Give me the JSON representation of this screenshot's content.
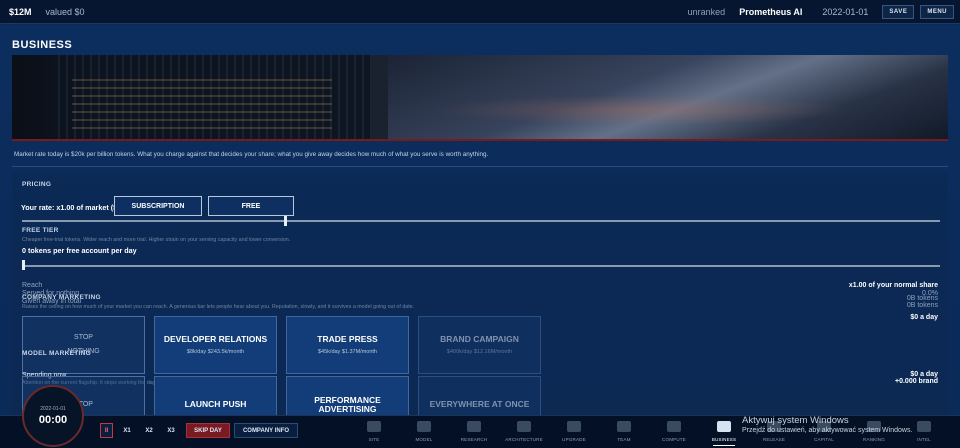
{
  "topbar": {
    "cash": "$12M",
    "valued": "valued $0",
    "rank": "unranked",
    "company": "Prometheus AI",
    "date": "2022-01-01",
    "save_label": "SAVE",
    "menu_label": "MENU"
  },
  "page": {
    "title": "BUSINESS",
    "intro": "Market rate today is $20k per billion tokens. What you charge against that decides your share; what you give away decides how much of what you serve is worth anything."
  },
  "pricing": {
    "heading": "PRICING",
    "rate_text": "Your rate: x1.00 of market ($20k/B tokens)",
    "options": [
      "SUBSCRIPTION",
      "FREE"
    ],
    "rate_multiplier": 1.0,
    "free_tier_heading": "FREE TIER",
    "free_tier_hint": "Cheaper free-trial tokens. Wider reach and more trial. Higher strain on your serving capacity and lower conversion.",
    "free_tier_value": "0 tokens per free account per day",
    "free_tier_fraction": 0.0,
    "reach_label": "Reach",
    "reach_value": "x1.00 of your normal share",
    "served_label": "Served for nothing",
    "served_value": "0.0%",
    "given_label": "Given away in total",
    "given_value": "0B tokens",
    "given_value2": "0B tokens"
  },
  "company_marketing": {
    "heading": "COMPANY MARKETING",
    "hint": "Raises the ceiling on how much of your market you can reach. A generous bar lets people hear about you. Reputation, slowly, and it survives a model going out of date.",
    "rate": "$0 a day",
    "cards": [
      {
        "title": "STOP",
        "sub": "NOTHING",
        "style": "ghost"
      },
      {
        "title": "DEVELOPER RELATIONS",
        "sub": "$8k/day   $243.5k/month",
        "style": "normal"
      },
      {
        "title": "TRADE PRESS",
        "sub": "$45k/day   $1.37M/month",
        "style": "normal"
      },
      {
        "title": "BRAND CAMPAIGN",
        "sub": "$400k/day   $12.16M/month",
        "style": "dim"
      }
    ]
  },
  "model_marketing": {
    "heading": "MODEL MARKETING",
    "spending_label": "Spending now",
    "hint": "Attention on the current flagship. It stops working the day the model's out of date.",
    "rate": "$0 a day",
    "brand": "+0.000 brand",
    "cards": [
      {
        "title": "STOP",
        "sub": "",
        "style": "ghost"
      },
      {
        "title": "LAUNCH PUSH",
        "sub": "",
        "style": "normal"
      },
      {
        "title": "PERFORMANCE ADVERTISING",
        "sub": "",
        "style": "normal"
      },
      {
        "title": "EVERYWHERE AT ONCE",
        "sub": "",
        "style": "dim"
      }
    ]
  },
  "clock": {
    "date": "2022-01-01",
    "time": "00:00"
  },
  "controls": {
    "pause": "II",
    "speeds": [
      "X1",
      "X2",
      "X3"
    ],
    "skip": "SKIP DAY",
    "info": "COMPANY INFO"
  },
  "nav": [
    {
      "label": "SITE",
      "icon": "site-icon"
    },
    {
      "label": "MODEL",
      "icon": "model-icon"
    },
    {
      "label": "RESEARCH",
      "icon": "research-icon"
    },
    {
      "label": "ARCHITECTURE",
      "icon": "architecture-icon"
    },
    {
      "label": "UPGRADE",
      "icon": "upgrade-icon"
    },
    {
      "label": "TEAM",
      "icon": "team-icon"
    },
    {
      "label": "COMPUTE",
      "icon": "compute-icon"
    },
    {
      "label": "BUSINESS",
      "icon": "briefcase-icon",
      "active": true
    },
    {
      "label": "RELEASE",
      "icon": "release-icon"
    },
    {
      "label": "CAPITAL",
      "icon": "capital-icon"
    },
    {
      "label": "RANKING",
      "icon": "ranking-icon"
    },
    {
      "label": "INTEL",
      "icon": "intel-icon"
    }
  ],
  "watermark": {
    "line1": "Aktywuj system Windows",
    "line2": "Przejdź do ustawień, aby aktywować system Windows."
  }
}
